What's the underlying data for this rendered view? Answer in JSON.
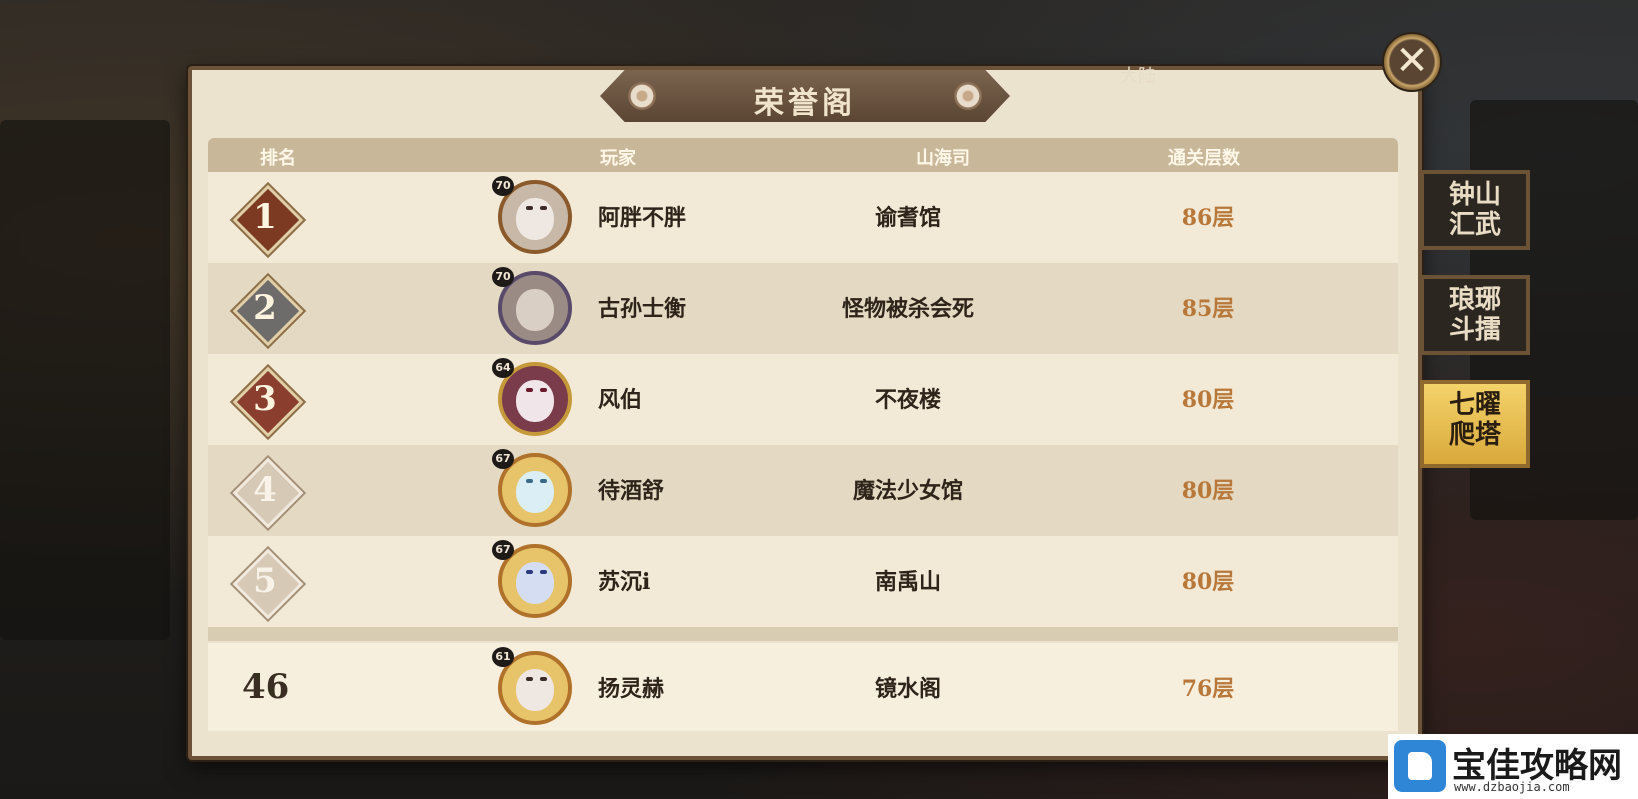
{
  "window": {
    "title": "荣誉阁",
    "region": "大陆"
  },
  "headers": {
    "rank": "排名",
    "player": "玩家",
    "guild": "山海司",
    "floors": "通关层数"
  },
  "rows": [
    {
      "rank": "1",
      "level": "70",
      "player": "阿胖不胖",
      "guild": "谕耆馆",
      "floors": "86层"
    },
    {
      "rank": "2",
      "level": "70",
      "player": "古孙士衡",
      "guild": "怪物被杀会死",
      "floors": "85层"
    },
    {
      "rank": "3",
      "level": "64",
      "player": "风伯",
      "guild": "不夜楼",
      "floors": "80层"
    },
    {
      "rank": "4",
      "level": "67",
      "player": "待酒舒",
      "guild": "魔法少女馆",
      "floors": "80层"
    },
    {
      "rank": "5",
      "level": "67",
      "player": "苏沉i",
      "guild": "南禹山",
      "floors": "80层"
    }
  ],
  "self_row": {
    "rank": "46",
    "level": "61",
    "player": "扬灵赫",
    "guild": "镜水阁",
    "floors": "76层"
  },
  "side_tabs": [
    {
      "line1": "钟山",
      "line2": "汇武",
      "active": false
    },
    {
      "line1": "琅琊",
      "line2": "斗擂",
      "active": false
    },
    {
      "line1": "七曜",
      "line2": "爬塔",
      "active": true
    }
  ],
  "close_icon": "close-icon",
  "logo": {
    "name": "宝佳攻略网",
    "url": "www.dzbaojia.com"
  },
  "colors": {
    "floor_text": "#b8783a",
    "active_tab": "#e9c157"
  }
}
